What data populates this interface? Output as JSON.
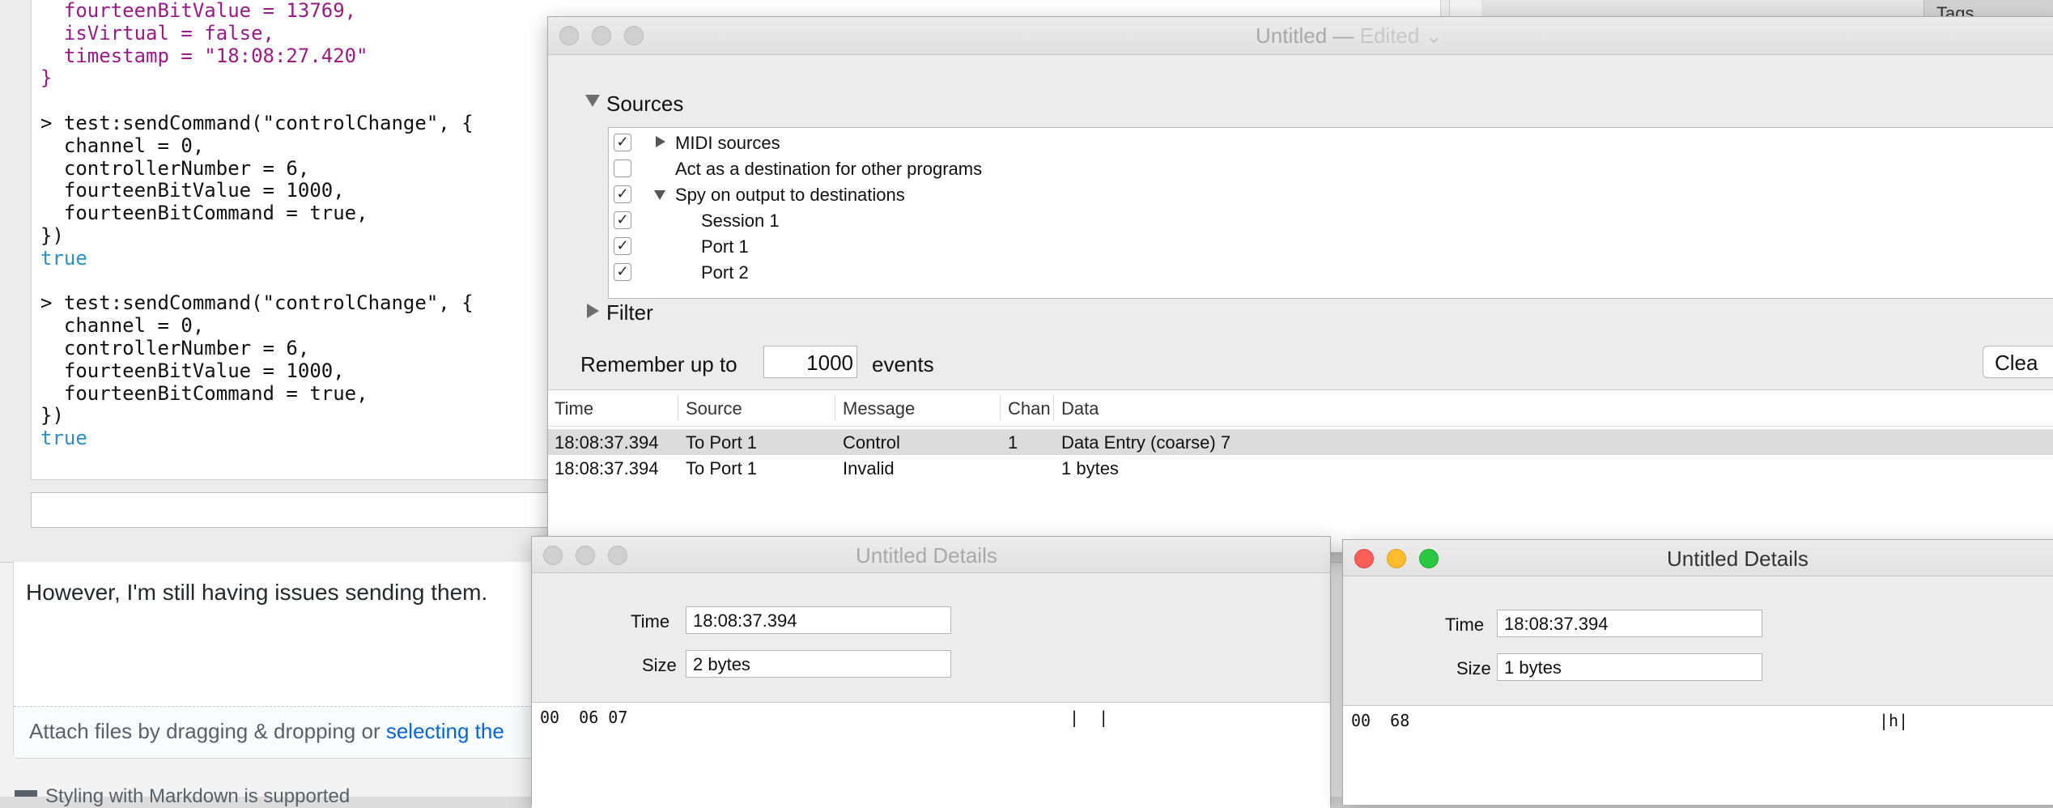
{
  "console": {
    "lines": [
      {
        "text": "  fourteenBitValue = 13769,",
        "color": "purple"
      },
      {
        "text": "  isVirtual = false,",
        "color": "purple"
      },
      {
        "text": "  timestamp = \"18:08:27.420\"",
        "color": "purple"
      },
      {
        "text": "}",
        "color": "purple"
      },
      {
        "text": "",
        "color": "black"
      },
      {
        "text": "> test:sendCommand(\"controlChange\", {",
        "color": "black"
      },
      {
        "text": "  channel = 0,",
        "color": "black"
      },
      {
        "text": "  controllerNumber = 6,",
        "color": "black"
      },
      {
        "text": "  fourteenBitValue = 1000,",
        "color": "black"
      },
      {
        "text": "  fourteenBitCommand = true,",
        "color": "black"
      },
      {
        "text": "})",
        "color": "black"
      },
      {
        "text": "true",
        "color": "blue"
      },
      {
        "text": "",
        "color": "black"
      },
      {
        "text": "> test:sendCommand(\"controlChange\", {",
        "color": "black"
      },
      {
        "text": "  channel = 0,",
        "color": "black"
      },
      {
        "text": "  controllerNumber = 6,",
        "color": "black"
      },
      {
        "text": "  fourteenBitValue = 1000,",
        "color": "black"
      },
      {
        "text": "  fourteenBitCommand = true,",
        "color": "black"
      },
      {
        "text": "})",
        "color": "black"
      },
      {
        "text": "true",
        "color": "blue"
      }
    ]
  },
  "browser": {
    "tags_label": "Tags",
    "comment_text": "However, I'm still having issues sending them.",
    "attach_text": "Attach files by dragging & dropping or ",
    "attach_link": "selecting the",
    "styling_text": "Styling with Markdown is supported"
  },
  "main_window": {
    "title": "Untitled — ",
    "title_edited": "Edited ⌄",
    "sources_label": "Sources",
    "sources": [
      {
        "label": "MIDI sources",
        "checked": true,
        "disclosure": "right",
        "indent": 0
      },
      {
        "label": "Act as a destination for other programs",
        "checked": false,
        "disclosure": "none",
        "indent": 0
      },
      {
        "label": "Spy on output to destinations",
        "checked": true,
        "disclosure": "down",
        "indent": 0
      },
      {
        "label": "Session 1",
        "checked": true,
        "disclosure": "none",
        "indent": 1
      },
      {
        "label": "Port 1",
        "checked": true,
        "disclosure": "none",
        "indent": 1
      },
      {
        "label": "Port 2",
        "checked": true,
        "disclosure": "none",
        "indent": 1
      }
    ],
    "filter_label": "Filter",
    "remember_label": "Remember up to",
    "remember_value": "1000",
    "events_label": "events",
    "clear_label": "Clea",
    "table": {
      "columns": [
        "Time",
        "Source",
        "Message",
        "Chan",
        "Data"
      ],
      "rows": [
        {
          "time": "18:08:37.394",
          "source": "To Port 1",
          "message": "Control",
          "chan": "1",
          "data": "Data Entry (coarse)   7",
          "selected": true
        },
        {
          "time": "18:08:37.394",
          "source": "To Port 1",
          "message": "Invalid",
          "chan": "",
          "data": "1 bytes",
          "selected": false
        }
      ]
    }
  },
  "details_left": {
    "title": "Untitled Details",
    "time_label": "Time",
    "time_value": "18:08:37.394",
    "size_label": "Size",
    "size_value": "2 bytes",
    "hex": "00  06 07",
    "ascii": "|  |"
  },
  "details_right": {
    "title": "Untitled Details",
    "time_label": "Time",
    "time_value": "18:08:37.394",
    "size_label": "Size",
    "size_value": "1 bytes",
    "hex": "00  68",
    "ascii": "|h|"
  }
}
